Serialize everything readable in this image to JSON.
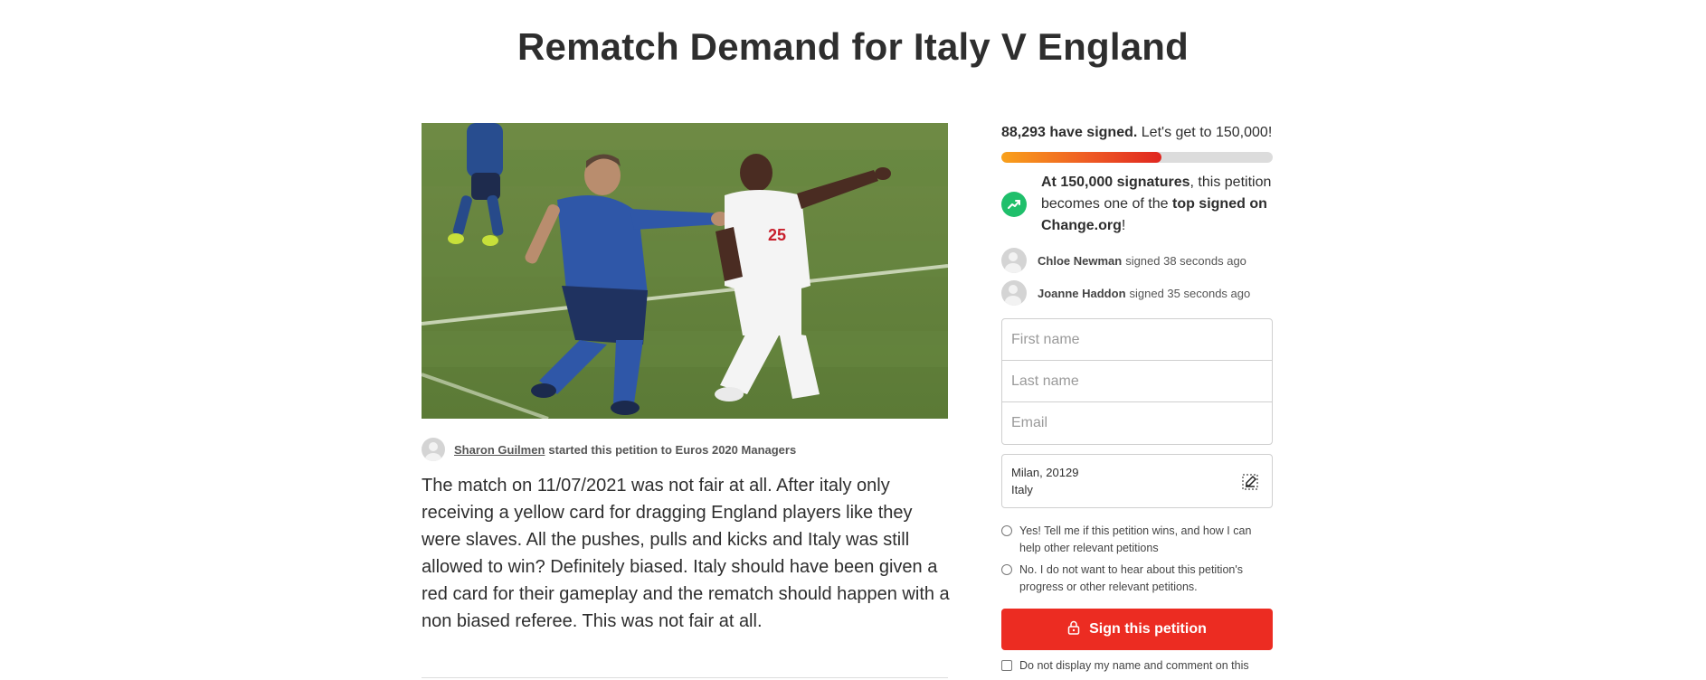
{
  "page": {
    "title": "Rematch Demand for Italy V England"
  },
  "petition": {
    "starter_name": "Sharon Guilmen",
    "starter_text": "started this petition to Euros 2020 Managers",
    "body": "The match on 11/07/2021 was not fair at all. After italy only receiving a yellow card for dragging England players like they were slaves. All the pushes, pulls and kicks and Italy was still allowed to win? Definitely biased. Italy should have been given a red card for their gameplay and the rematch should happen with a non biased referee. This was not fair at all.",
    "image_alt": "Football players on pitch",
    "player_number": "25"
  },
  "sidebar": {
    "signed_count": "88,293 have signed.",
    "goal_text": "Let's get to 150,000!",
    "progress_fraction": 0.59,
    "milestone": {
      "bold_1": "At 150,000 signatures",
      "text_1": ", this petition becomes one of the ",
      "bold_2": "top signed on Change.org",
      "text_2": "!"
    },
    "recent_signers": [
      {
        "name": "Chloe Newman",
        "time": "signed 38 seconds ago"
      },
      {
        "name": "Joanne Haddon",
        "time": "signed 35 seconds ago"
      }
    ],
    "form": {
      "first_name_placeholder": "First name",
      "last_name_placeholder": "Last name",
      "email_placeholder": "Email"
    },
    "location": {
      "city_postcode": "Milan, 20129",
      "country": "Italy"
    },
    "options": {
      "yes_label": "Yes! Tell me if this petition wins, and how I can help other relevant petitions",
      "no_label": "No. I do not want to hear about this petition's progress or other relevant petitions."
    },
    "sign_button_label": "Sign this petition",
    "hide_name_label": "Do not display my name and comment on this"
  },
  "colors": {
    "accent_red": "#ec2c22",
    "progress_orange": "#f9a11b",
    "milestone_green": "#1fbf6b"
  },
  "icons": {
    "trend": "trending-up-icon",
    "lock": "lock-icon",
    "edit": "edit-icon",
    "avatar": "user-avatar-icon"
  }
}
